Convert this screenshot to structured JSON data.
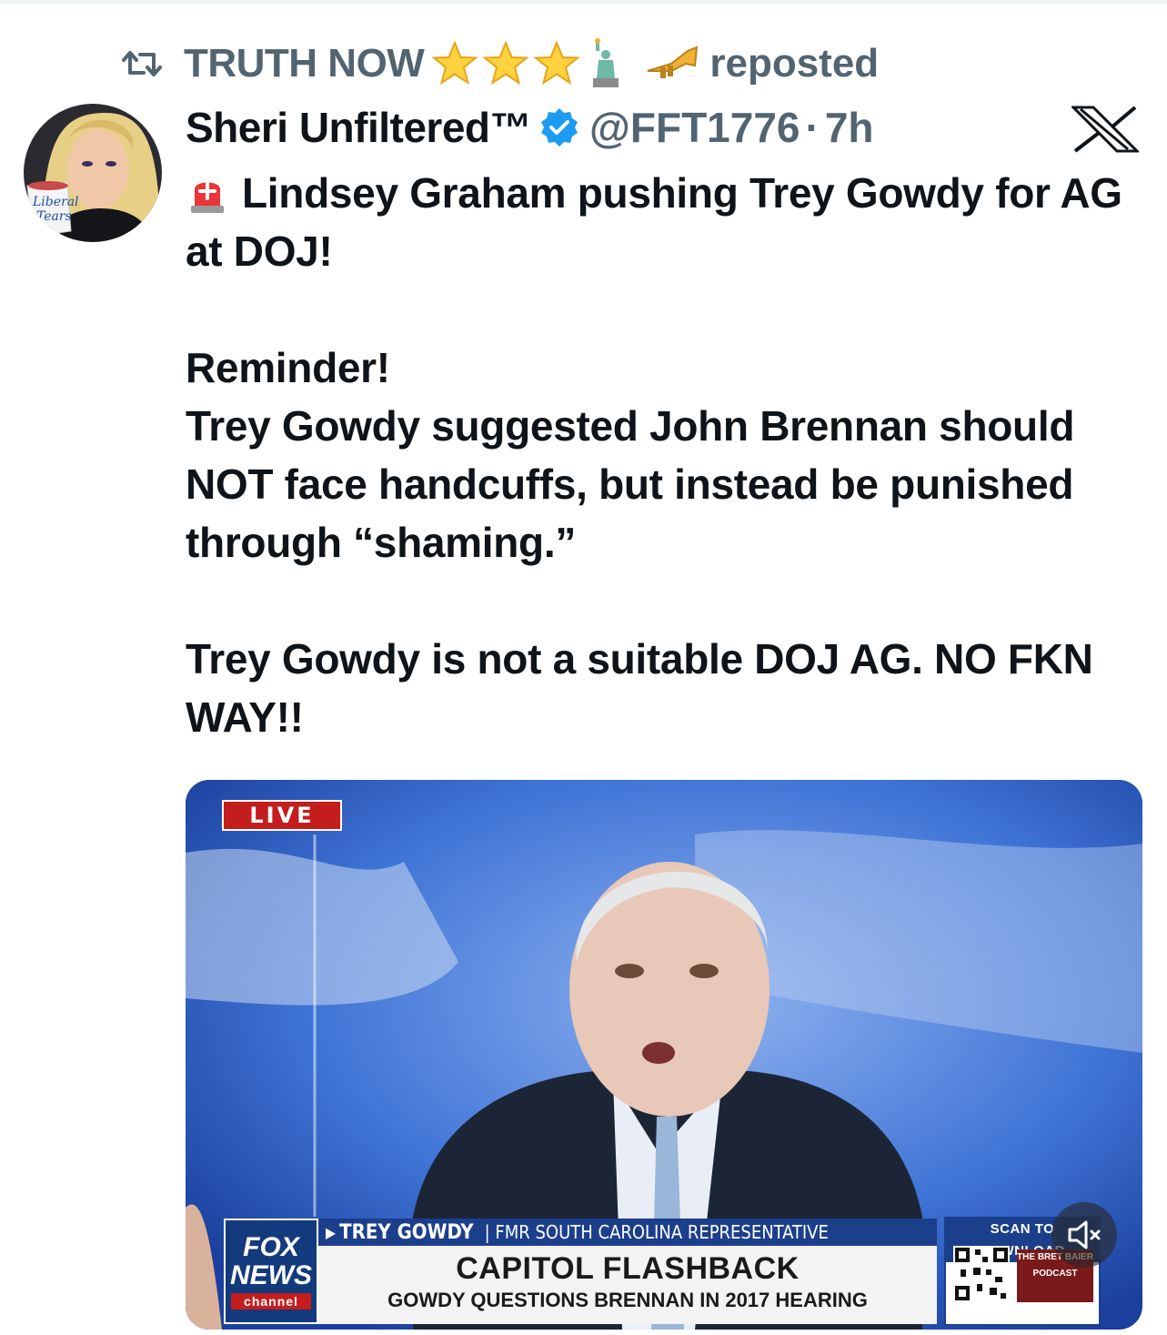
{
  "repost": {
    "name": "TRUTH NOW",
    "emojis": [
      "star-emoji",
      "star-emoji",
      "star-emoji",
      "statue-of-liberty-emoji",
      "trumpet-emoji"
    ],
    "label": "reposted"
  },
  "author": {
    "display_name": "Sheri Unfiltered™",
    "handle": "@FFT1776",
    "separator": "·",
    "time": "7h",
    "verified": true,
    "avatar_mug_text": "Liberal Tears"
  },
  "post": {
    "line1": "Lindsey Graham pushing Trey Gowdy for AG at DOJ!",
    "para2_line1": "Reminder!",
    "para2_line2": "Trey Gowdy suggested John Brennan should NOT face handcuffs, but instead be punished through “shaming.”",
    "para3": "Trey Gowdy is not a suitable DOJ AG. NO FKN WAY!!"
  },
  "media": {
    "live_badge": "LIVE",
    "chyron_name": "TREY GOWDY",
    "chyron_role": "| FMR SOUTH CAROLINA REPRESENTATIVE",
    "chyron_title": "CAPITOL FLASHBACK",
    "chyron_subtitle": "GOWDY QUESTIONS BRENNAN IN 2017 HEARING",
    "network_line1": "FOX",
    "network_line2": "NEWS",
    "network_line3": "channel",
    "scan_label": "SCAN TO DOWNLOAD",
    "podcast_text": "THE BRET BAIER PODCAST"
  },
  "colors": {
    "secondary_text": "#536471",
    "verified_blue": "#1d9bf0",
    "fox_blue": "#1c3f8c",
    "live_red": "#c41d1d"
  }
}
